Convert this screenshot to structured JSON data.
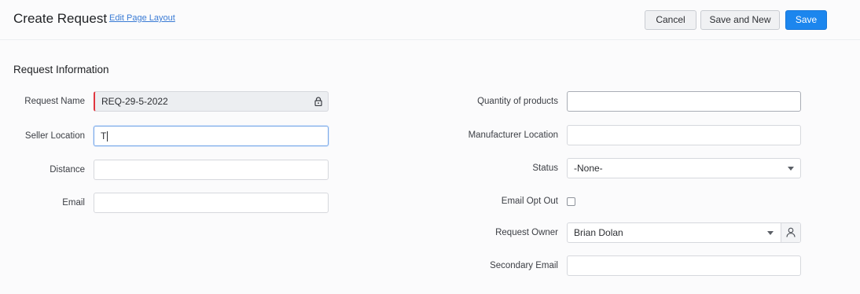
{
  "header": {
    "title": "Create Request",
    "edit_layout_link": "Edit Page Layout",
    "cancel_label": "Cancel",
    "save_and_new_label": "Save and New",
    "save_label": "Save"
  },
  "section": {
    "title": "Request Information"
  },
  "left_fields": {
    "request_name": {
      "label": "Request Name",
      "value": "REQ-29-5-2022",
      "icon": "lock-icon"
    },
    "seller_location": {
      "label": "Seller Location",
      "value": "T"
    },
    "distance": {
      "label": "Distance",
      "value": ""
    },
    "email": {
      "label": "Email",
      "value": ""
    }
  },
  "right_fields": {
    "quantity": {
      "label": "Quantity of products",
      "value": ""
    },
    "manufacturer_location": {
      "label": "Manufacturer Location",
      "value": ""
    },
    "status": {
      "label": "Status",
      "value": "-None-"
    },
    "email_opt_out": {
      "label": "Email Opt Out",
      "checked": false
    },
    "request_owner": {
      "label": "Request Owner",
      "value": "Brian Dolan",
      "icon": "user-lookup-icon"
    },
    "secondary_email": {
      "label": "Secondary Email",
      "value": ""
    }
  },
  "colors": {
    "primary": "#1c86ee",
    "required_marker": "#e0363f",
    "link": "#3a7bd5"
  }
}
